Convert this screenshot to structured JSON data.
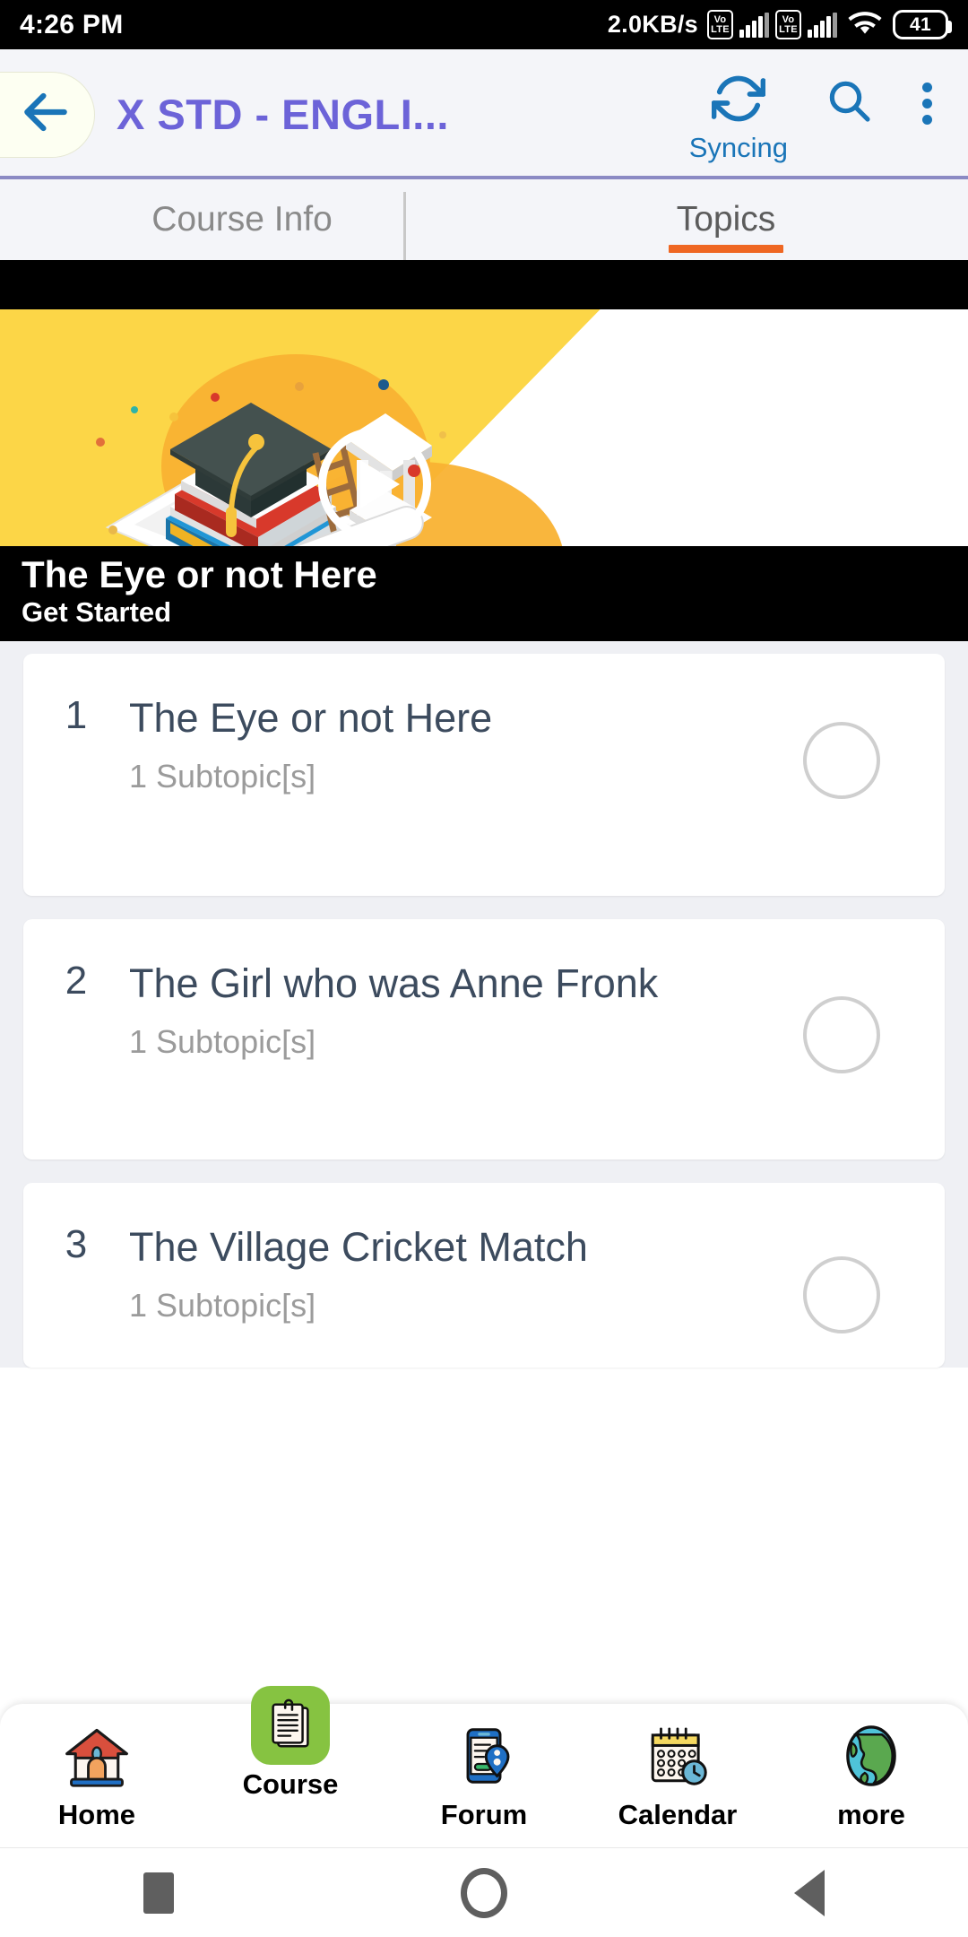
{
  "status_bar": {
    "time": "4:26 PM",
    "net_speed": "2.0KB/s",
    "sim1_label": "VoLTE",
    "sim2_label": "VoLTE",
    "battery": "41"
  },
  "app_bar": {
    "back_icon": "arrow-left-icon",
    "title": "X STD - ENGLI...",
    "sync_icon": "sync-icon",
    "sync_label": "Syncing",
    "search_icon": "search-icon",
    "overflow_icon": "more-vertical-icon",
    "accent_color": "#6c63d8",
    "icon_color": "#1a75b8"
  },
  "tabs": [
    {
      "label": "Course Info",
      "active": false
    },
    {
      "label": "Topics",
      "active": true
    }
  ],
  "tabs_accent": "#ef6723",
  "banner": {
    "illustration_name": "graduation-education-illustration",
    "play_icon": "play-circle-icon",
    "title": "The Eye or not Here",
    "subtitle": "Get Started",
    "bg_color": "#fcd647"
  },
  "topics": [
    {
      "number": "1",
      "title": "The Eye or not Here",
      "subtitle": "1 Subtopic[s]",
      "completed": false
    },
    {
      "number": "2",
      "title": "The Girl who was Anne Fronk",
      "subtitle": "1 Subtopic[s]",
      "completed": false
    },
    {
      "number": "3",
      "title": "The Village Cricket Match",
      "subtitle": "1 Subtopic[s]",
      "completed": false
    }
  ],
  "bottom_nav": {
    "active_color": "#86c341",
    "items": [
      {
        "label": "Home",
        "icon": "house-icon",
        "active": false
      },
      {
        "label": "Course",
        "icon": "document-icon",
        "active": true
      },
      {
        "label": "Forum",
        "icon": "mobile-chat-icon",
        "active": false
      },
      {
        "label": "Calendar",
        "icon": "calendar-clock-icon",
        "active": false
      },
      {
        "label": "more",
        "icon": "globe-icon",
        "active": false
      }
    ]
  },
  "android_nav": {
    "recents_icon": "square-icon",
    "home_icon": "circle-icon",
    "back_icon": "triangle-left-icon"
  }
}
